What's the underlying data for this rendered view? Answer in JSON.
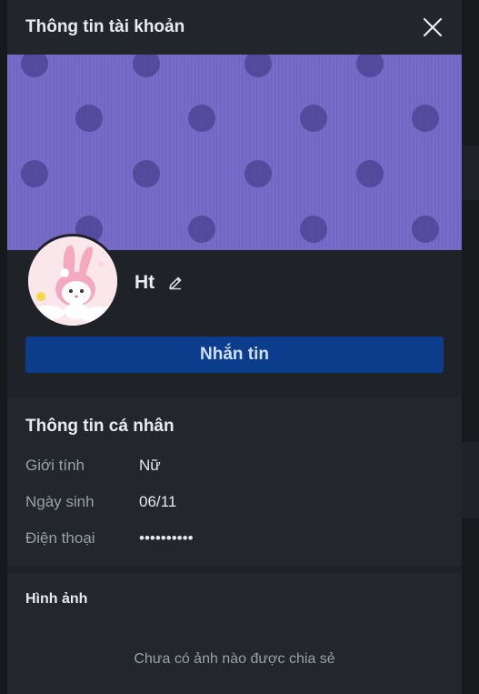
{
  "modal": {
    "title": "Thông tin tài khoản"
  },
  "profile": {
    "name": "Ht",
    "message_button": "Nhắn tin"
  },
  "personal_info": {
    "title": "Thông tin cá nhân",
    "rows": [
      {
        "label": "Giới tính",
        "value": "Nữ"
      },
      {
        "label": "Ngày sinh",
        "value": "06/11"
      },
      {
        "label": "Điện thoại",
        "value": "••••••••••"
      }
    ]
  },
  "images": {
    "title": "Hình ảnh",
    "empty_text": "Chưa có ảnh nào được chia sẻ"
  },
  "colors": {
    "cover": "#7466c3",
    "cover_dots": "#4f4597",
    "primary_button": "#0c3c8c",
    "panel": "#1f2227"
  }
}
